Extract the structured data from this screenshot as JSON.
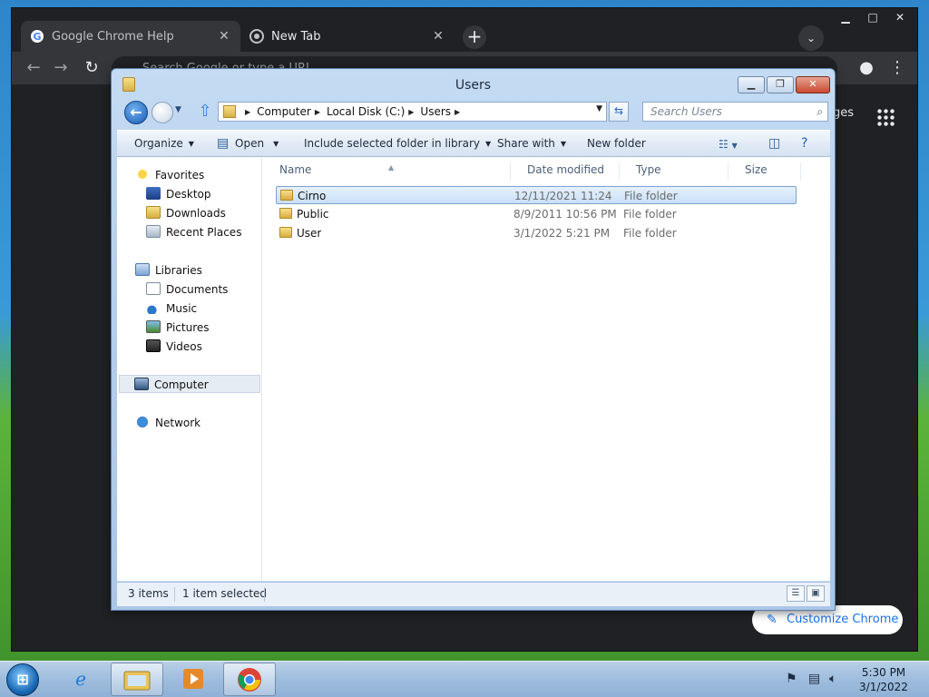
{
  "chrome": {
    "tabs": [
      {
        "title": "Google Chrome Help",
        "active": false
      },
      {
        "title": "New Tab",
        "active": true
      }
    ],
    "omnibox_placeholder": "Search Google or type a URL",
    "ntp_right_text": "ges",
    "customize_label": "Customize Chrome"
  },
  "explorer": {
    "title": "Users",
    "breadcrumb": [
      "Computer",
      "Local Disk (C:)",
      "Users"
    ],
    "search_placeholder": "Search Users",
    "commands": {
      "organize": "Organize",
      "open": "Open",
      "include": "Include selected folder in library",
      "share": "Share with",
      "new_folder": "New folder"
    },
    "nav": {
      "favorites": "Favorites",
      "desktop": "Desktop",
      "downloads": "Downloads",
      "recent": "Recent Places",
      "libraries": "Libraries",
      "documents": "Documents",
      "music": "Music",
      "pictures": "Pictures",
      "videos": "Videos",
      "computer": "Computer",
      "network": "Network"
    },
    "columns": {
      "name": "Name",
      "date": "Date modified",
      "type": "Type",
      "size": "Size"
    },
    "files": [
      {
        "name": "Cirno",
        "date": "12/11/2021 11:24 ...",
        "type": "File folder",
        "selected": true
      },
      {
        "name": "Public",
        "date": "8/9/2011 10:56 PM",
        "type": "File folder",
        "selected": false
      },
      {
        "name": "User",
        "date": "3/1/2022 5:21 PM",
        "type": "File folder",
        "selected": false
      }
    ],
    "status": {
      "count": "3 items",
      "selected": "1 item selected"
    }
  },
  "taskbar": {
    "time": "5:30 PM",
    "date": "3/1/2022"
  },
  "colors": {
    "chrome_bg": "#202124",
    "chrome_tab": "#35363a",
    "selection": "#c9e0f7",
    "link_blue": "#1a73e8"
  }
}
